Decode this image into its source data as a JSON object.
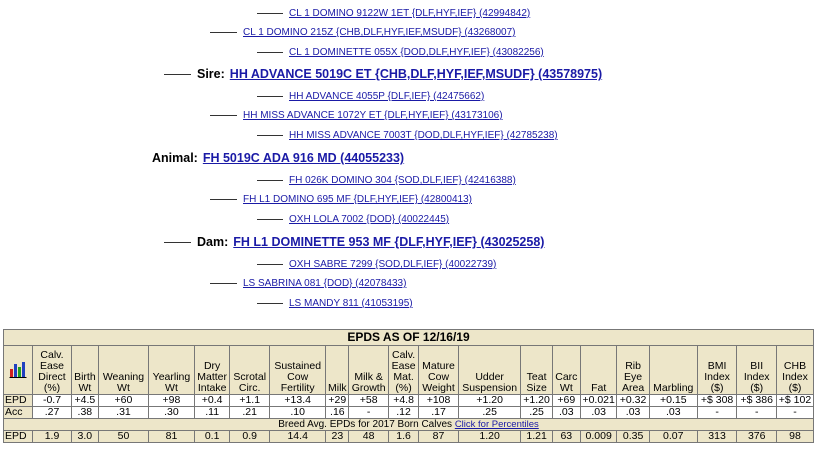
{
  "pedigree": {
    "sire_sire_sire": "CL 1 DOMINO 9122W 1ET {DLF,HYF,IEF} (42994842)",
    "sire_sire": "CL 1 DOMINO 215Z {CHB,DLF,HYF,IEF,MSUDF} (43268007)",
    "sire_sire_dam": "CL 1 DOMINETTE 055X {DOD,DLF,HYF,IEF} (43082256)",
    "sire_label": "Sire:",
    "sire": "HH ADVANCE 5019C ET {CHB,DLF,HYF,IEF,MSUDF} (43578975)",
    "sire_dam_sire": "HH ADVANCE 4055P {DLF,IEF} (42475662)",
    "sire_dam": "HH MISS ADVANCE 1072Y ET {DLF,HYF,IEF} (43173106)",
    "sire_dam_dam": "HH MISS ADVANCE 7003T {DOD,DLF,HYF,IEF} (42785238)",
    "animal_label": "Animal:",
    "animal": "FH 5019C ADA 916 MD (44055233)",
    "dam_sire_sire": "FH 026K DOMINO 304 {SOD,DLF,IEF} (42416388)",
    "dam_sire": "FH L1 DOMINO 695 MF {DLF,HYF,IEF} (42800413)",
    "dam_sire_dam": "OXH LOLA 7002 {DOD} (40022445)",
    "dam_label": "Dam:",
    "dam": "FH L1 DOMINETTE 953 MF {DLF,HYF,IEF} (43025258)",
    "dam_dam_sire": "OXH SABRE 7299 {SOD,DLF,IEF} (40022739)",
    "dam_dam": "LS SABRINA 081 {DOD} (42078433)",
    "dam_dam_dam": "LS MANDY 811 (41053195)"
  },
  "epd_table": {
    "title": "EPDS AS OF 12/16/19",
    "headers": [
      "Calv. Ease Direct (%)",
      "Birth Wt",
      "Weaning Wt",
      "Yearling Wt",
      "Dry Matter Intake",
      "Scrotal Circ.",
      "Sustained Cow Fertility",
      "Milk",
      "Milk & Growth",
      "Calv. Ease Mat. (%)",
      "Mature Cow Weight",
      "Udder Suspension",
      "Teat Size",
      "Carc Wt",
      "Fat",
      "Rib Eye Area",
      "Marbling",
      "BMI Index ($)",
      "BII Index ($)",
      "CHB Index ($)"
    ],
    "epd_label": "EPD",
    "acc_label": "Acc",
    "epd_values": [
      "-0.7",
      "+4.5",
      "+60",
      "+98",
      "+0.4",
      "+1.1",
      "+13.4",
      "+29",
      "+58",
      "+4.8",
      "+108",
      "+1.20",
      "+1.20",
      "+69",
      "+0.021",
      "+0.32",
      "+0.15",
      "+$ 308",
      "+$ 386",
      "+$ 102"
    ],
    "acc_values": [
      ".27",
      ".38",
      ".31",
      ".30",
      ".11",
      ".21",
      ".10",
      ".16",
      "-",
      ".12",
      ".17",
      ".25",
      ".25",
      ".03",
      ".03",
      ".03",
      ".03",
      "-",
      "-",
      "-"
    ],
    "breed_avg_text": "Breed Avg. EPDs for 2017 Born Calves",
    "percentiles_link": "Click for Percentiles",
    "breed_epd_label": "EPD",
    "breed_values": [
      "1.9",
      "3.0",
      "50",
      "81",
      "0.1",
      "0.9",
      "14.4",
      "23",
      "48",
      "1.6",
      "87",
      "1.20",
      "1.21",
      "63",
      "0.009",
      "0.35",
      "0.07",
      "313",
      "376",
      "98"
    ]
  },
  "icons": {
    "chart": "bar-chart-icon"
  }
}
